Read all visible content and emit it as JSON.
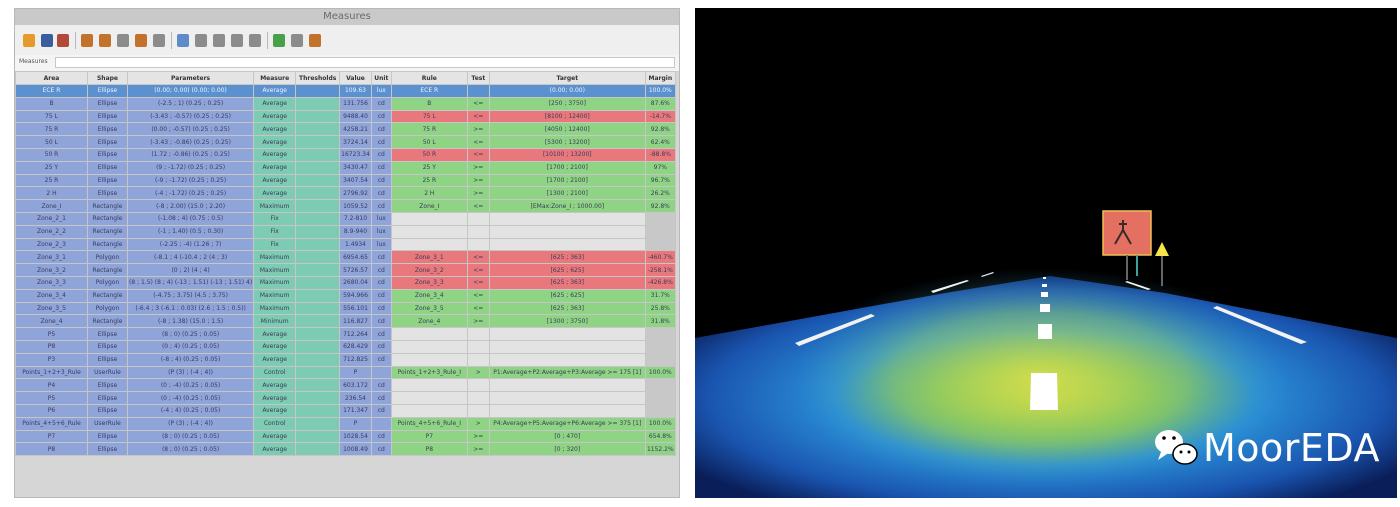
{
  "measures_window": {
    "title": "Measures",
    "filter_label": "Measures",
    "columns": [
      "Area",
      "Shape",
      "Parameters",
      "Measure",
      "Thresholds",
      "Value",
      "Unit",
      "Rule",
      "Test",
      "Target",
      "Margin"
    ],
    "rows": [
      {
        "status": "selected",
        "area": "ECE R",
        "shape": "Ellipse",
        "params": "(0.00; 0.00) (0.00; 0.00)",
        "measure": "Average",
        "value": "109.63",
        "unit": "lux",
        "rule": "ECE R",
        "test": "",
        "target": "(0.00; 0.00)",
        "margin": "100.0%"
      },
      {
        "status": "ok",
        "area": "B",
        "shape": "Ellipse",
        "params": "(-2.5 ; 1) (0.25 ; 0.25)",
        "measure": "Average",
        "value": "131.756",
        "unit": "cd",
        "rule": "B",
        "test": "<=",
        "target": "[250 ; 3750]",
        "margin": "87.6%"
      },
      {
        "status": "fail",
        "area": "75 L",
        "shape": "Ellipse",
        "params": "(-3.43 ; -0.57) (0.25 ; 0.25)",
        "measure": "Average",
        "value": "9488.40",
        "unit": "cd",
        "rule": "75 L",
        "test": "<=",
        "target": "[8100 ; 12400]",
        "margin": "-14.7%"
      },
      {
        "status": "ok",
        "area": "75 R",
        "shape": "Ellipse",
        "params": "(0.00 ; -0.57) (0.25 ; 0.25)",
        "measure": "Average",
        "value": "4258.21",
        "unit": "cd",
        "rule": "75 R",
        "test": ">=",
        "target": "[4050 ; 12400]",
        "margin": "92.8%"
      },
      {
        "status": "ok",
        "area": "50 L",
        "shape": "Ellipse",
        "params": "(-3.43 ; -0.86) (0.25 ; 0.25)",
        "measure": "Average",
        "value": "3724.14",
        "unit": "cd",
        "rule": "50 L",
        "test": "<=",
        "target": "[5300 ; 13200]",
        "margin": "62.4%"
      },
      {
        "status": "fail",
        "area": "50 R",
        "shape": "Ellipse",
        "params": "(1.72 ; -0.86) (0.25 ; 0.25)",
        "measure": "Average",
        "value": "16723.34",
        "unit": "cd",
        "rule": "50 R",
        "test": "<=",
        "target": "[10100 ; 13200]",
        "margin": "-88.8%"
      },
      {
        "status": "ok",
        "area": "25 Y",
        "shape": "Ellipse",
        "params": "(9 ; -1.72) (0.25 ; 0.25)",
        "measure": "Average",
        "value": "3430.47",
        "unit": "cd",
        "rule": "25 Y",
        "test": ">=",
        "target": "[1700 ; 2100]",
        "margin": "97%"
      },
      {
        "status": "ok",
        "area": "25 R",
        "shape": "Ellipse",
        "params": "(-9 ; -1.72) (0.25 ; 0.25)",
        "measure": "Average",
        "value": "3407.54",
        "unit": "cd",
        "rule": "25 R",
        "test": ">=",
        "target": "[1700 ; 2100]",
        "margin": "96.7%"
      },
      {
        "status": "ok",
        "area": "2 H",
        "shape": "Ellipse",
        "params": "(-4 ; -1.72) (0.25 ; 0.25)",
        "measure": "Average",
        "value": "2796.92",
        "unit": "cd",
        "rule": "2 H",
        "test": ">=",
        "target": "[1300 ; 2100]",
        "margin": "26.2%"
      },
      {
        "status": "ok",
        "area": "Zone_I",
        "shape": "Rectangle",
        "params": "(-8 ; 2.00) (15.0 ; 2.20)",
        "measure": "Maximum",
        "value": "1059.52",
        "unit": "cd",
        "rule": "Zone_I",
        "test": "<=",
        "target": "[EMax:Zone_I ; 1000.00]",
        "margin": "92.8%"
      },
      {
        "status": "none",
        "area": "Zone_2_1",
        "shape": "Rectangle",
        "params": "(-1.08 ; 4) (0.75 ; 0.5)",
        "measure": "Fix",
        "value": "7.2-810",
        "unit": "lux",
        "rule": "",
        "test": "",
        "target": "",
        "margin": ""
      },
      {
        "status": "none",
        "area": "Zone_2_2",
        "shape": "Rectangle",
        "params": "(-1 ; 1.40) (0.5 ; 0.30)",
        "measure": "Fix",
        "value": "8.9-940",
        "unit": "lux",
        "rule": "",
        "test": "",
        "target": "",
        "margin": ""
      },
      {
        "status": "none",
        "area": "Zone_2_3",
        "shape": "Rectangle",
        "params": "(-2.25 ; -4) (1.26 ; 7)",
        "measure": "Fix",
        "value": "1.4934",
        "unit": "lux",
        "rule": "",
        "test": "",
        "target": "",
        "margin": ""
      },
      {
        "status": "fail",
        "area": "Zone_3_1",
        "shape": "Polygon",
        "params": "(-8.1 ; 4 (-10.4 ; 2 (4 ; 3)",
        "measure": "Maximum",
        "value": "6954.65",
        "unit": "cd",
        "rule": "Zone_3_1",
        "test": "<=",
        "target": "[625 ; 363]",
        "margin": "-460.7%"
      },
      {
        "status": "fail",
        "area": "Zone_3_2",
        "shape": "Rectangle",
        "params": "(0 ; 2) (4 ; 4)",
        "measure": "Maximum",
        "value": "5726.57",
        "unit": "cd",
        "rule": "Zone_3_2",
        "test": "<=",
        "target": "[625 ; 625]",
        "margin": "-258.1%"
      },
      {
        "status": "fail",
        "area": "Zone_3_3",
        "shape": "Polygon",
        "params": "(8 ; 1.5) (8 ; 4) (-13 ; 1.51) (-13 ; 1.51) 4)",
        "measure": "Maximum",
        "value": "2680.04",
        "unit": "cd",
        "rule": "Zone_3_3",
        "test": "<=",
        "target": "[625 ; 363]",
        "margin": "-426.8%"
      },
      {
        "status": "ok",
        "area": "Zone_3_4",
        "shape": "Rectangle",
        "params": "(-4.75 ; 3.75) (4.5 ; 3.75)",
        "measure": "Maximum",
        "value": "594.966",
        "unit": "cd",
        "rule": "Zone_3_4",
        "test": "<=",
        "target": "[625 ; 625]",
        "margin": "31.7%"
      },
      {
        "status": "ok",
        "area": "Zone_3_5",
        "shape": "Polygon",
        "params": "(-6.4 ; 3 (-6.1 ; 0.03) (2.6 ; 1.5 ; 0.5))",
        "measure": "Maximum",
        "value": "556.101",
        "unit": "cd",
        "rule": "Zone_3_5",
        "test": "<=",
        "target": "[625 ; 363]",
        "margin": "25.8%"
      },
      {
        "status": "ok",
        "area": "Zone_4",
        "shape": "Rectangle",
        "params": "(-8 ; 1.38) (15.0 ; 1.5)",
        "measure": "Minimum",
        "value": "116.827",
        "unit": "cd",
        "rule": "Zone_4",
        "test": ">=",
        "target": "[1300 ; 3750]",
        "margin": "31.8%"
      },
      {
        "status": "none",
        "area": "P5",
        "shape": "Ellipse",
        "params": "(8 ; 0) (0.25 ; 0.05)",
        "measure": "Average",
        "value": "712.264",
        "unit": "cd",
        "rule": "",
        "test": "",
        "target": "",
        "margin": ""
      },
      {
        "status": "none",
        "area": "P8",
        "shape": "Ellipse",
        "params": "(0 ; 4) (0.25 ; 0.05)",
        "measure": "Average",
        "value": "628.429",
        "unit": "cd",
        "rule": "",
        "test": "",
        "target": "",
        "margin": ""
      },
      {
        "status": "none",
        "area": "P3",
        "shape": "Ellipse",
        "params": "(-8 ; 4) (0.25 ; 0.05)",
        "measure": "Average",
        "value": "712.825",
        "unit": "cd",
        "rule": "",
        "test": "",
        "target": "",
        "margin": ""
      },
      {
        "status": "ok",
        "area": "Points_1+2+3_Rule",
        "shape": "UserRule",
        "params": "(P (3) ; (-4 ; 4))",
        "measure": "Control",
        "value": "P",
        "unit": "",
        "rule": "Points_1+2+3_Rule_I",
        "test": ">",
        "target": "P1:Average+P2:Average+P3:Average >= 175 [1]",
        "margin": "100.0%"
      },
      {
        "status": "none",
        "area": "P4",
        "shape": "Ellipse",
        "params": "(0 ; -4) (0.25 ; 0.05)",
        "measure": "Average",
        "value": "603.172",
        "unit": "cd",
        "rule": "",
        "test": "",
        "target": "",
        "margin": ""
      },
      {
        "status": "none",
        "area": "P5",
        "shape": "Ellipse",
        "params": "(0 ; -4) (0.25 ; 0.05)",
        "measure": "Average",
        "value": "236.54",
        "unit": "cd",
        "rule": "",
        "test": "",
        "target": "",
        "margin": ""
      },
      {
        "status": "none",
        "area": "P6",
        "shape": "Ellipse",
        "params": "(-4 ; 4) (0.25 ; 0.05)",
        "measure": "Average",
        "value": "171.347",
        "unit": "cd",
        "rule": "",
        "test": "",
        "target": "",
        "margin": ""
      },
      {
        "status": "ok",
        "area": "Points_4+5+6_Rule",
        "shape": "UserRule",
        "params": "(P (3) ; (-4 ; 4))",
        "measure": "Control",
        "value": "P",
        "unit": "",
        "rule": "Points_4+5+6_Rule_I",
        "test": ">",
        "target": "P4:Average+P5:Average+P6:Average >= 375 [1]",
        "margin": "100.0%"
      },
      {
        "status": "ok",
        "area": "P7",
        "shape": "Ellipse",
        "params": "(8 ; 0) (0.25 ; 0.05)",
        "measure": "Average",
        "value": "1028.54",
        "unit": "cd",
        "rule": "P7",
        "test": ">=",
        "target": "[0 ; 470]",
        "margin": "654.8%"
      },
      {
        "status": "ok",
        "area": "P8",
        "shape": "Ellipse",
        "params": "(8 ; 0) (0.25 ; 0.05)",
        "measure": "Average",
        "value": "1008.49",
        "unit": "cd",
        "rule": "P8",
        "test": ">=",
        "target": "[0 ; 320]",
        "margin": "1152.2%"
      }
    ]
  },
  "road_render": {
    "background_color": "#000000",
    "beam_color": "#1c7fd0",
    "hotspot_color": "#b9d43a",
    "brand": "MoorEDA",
    "brand_icon": "wechat-icon"
  }
}
